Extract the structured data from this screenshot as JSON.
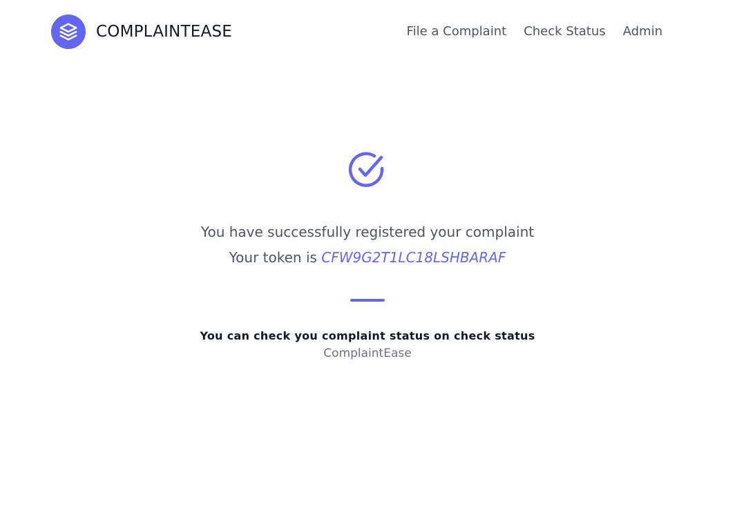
{
  "brand": {
    "name": "COMPLAINTEASE",
    "icon": "layers-icon",
    "color": "#6366f1"
  },
  "nav": {
    "items": [
      {
        "label": "File a Complaint"
      },
      {
        "label": "Check Status"
      },
      {
        "label": "Admin"
      }
    ]
  },
  "confirmation": {
    "icon": "check-circle-icon",
    "line1": "You have successfully registered your complaint",
    "token_prefix": "Your token is ",
    "token": "CFW9G2T1LC18LSHBARAF",
    "hint": "You can check you complaint status on check status",
    "brand_footer": "ComplaintEase"
  },
  "colors": {
    "accent": "#6366f1",
    "heading": "#111827",
    "text": "#4b5563",
    "muted": "#6b7280"
  }
}
